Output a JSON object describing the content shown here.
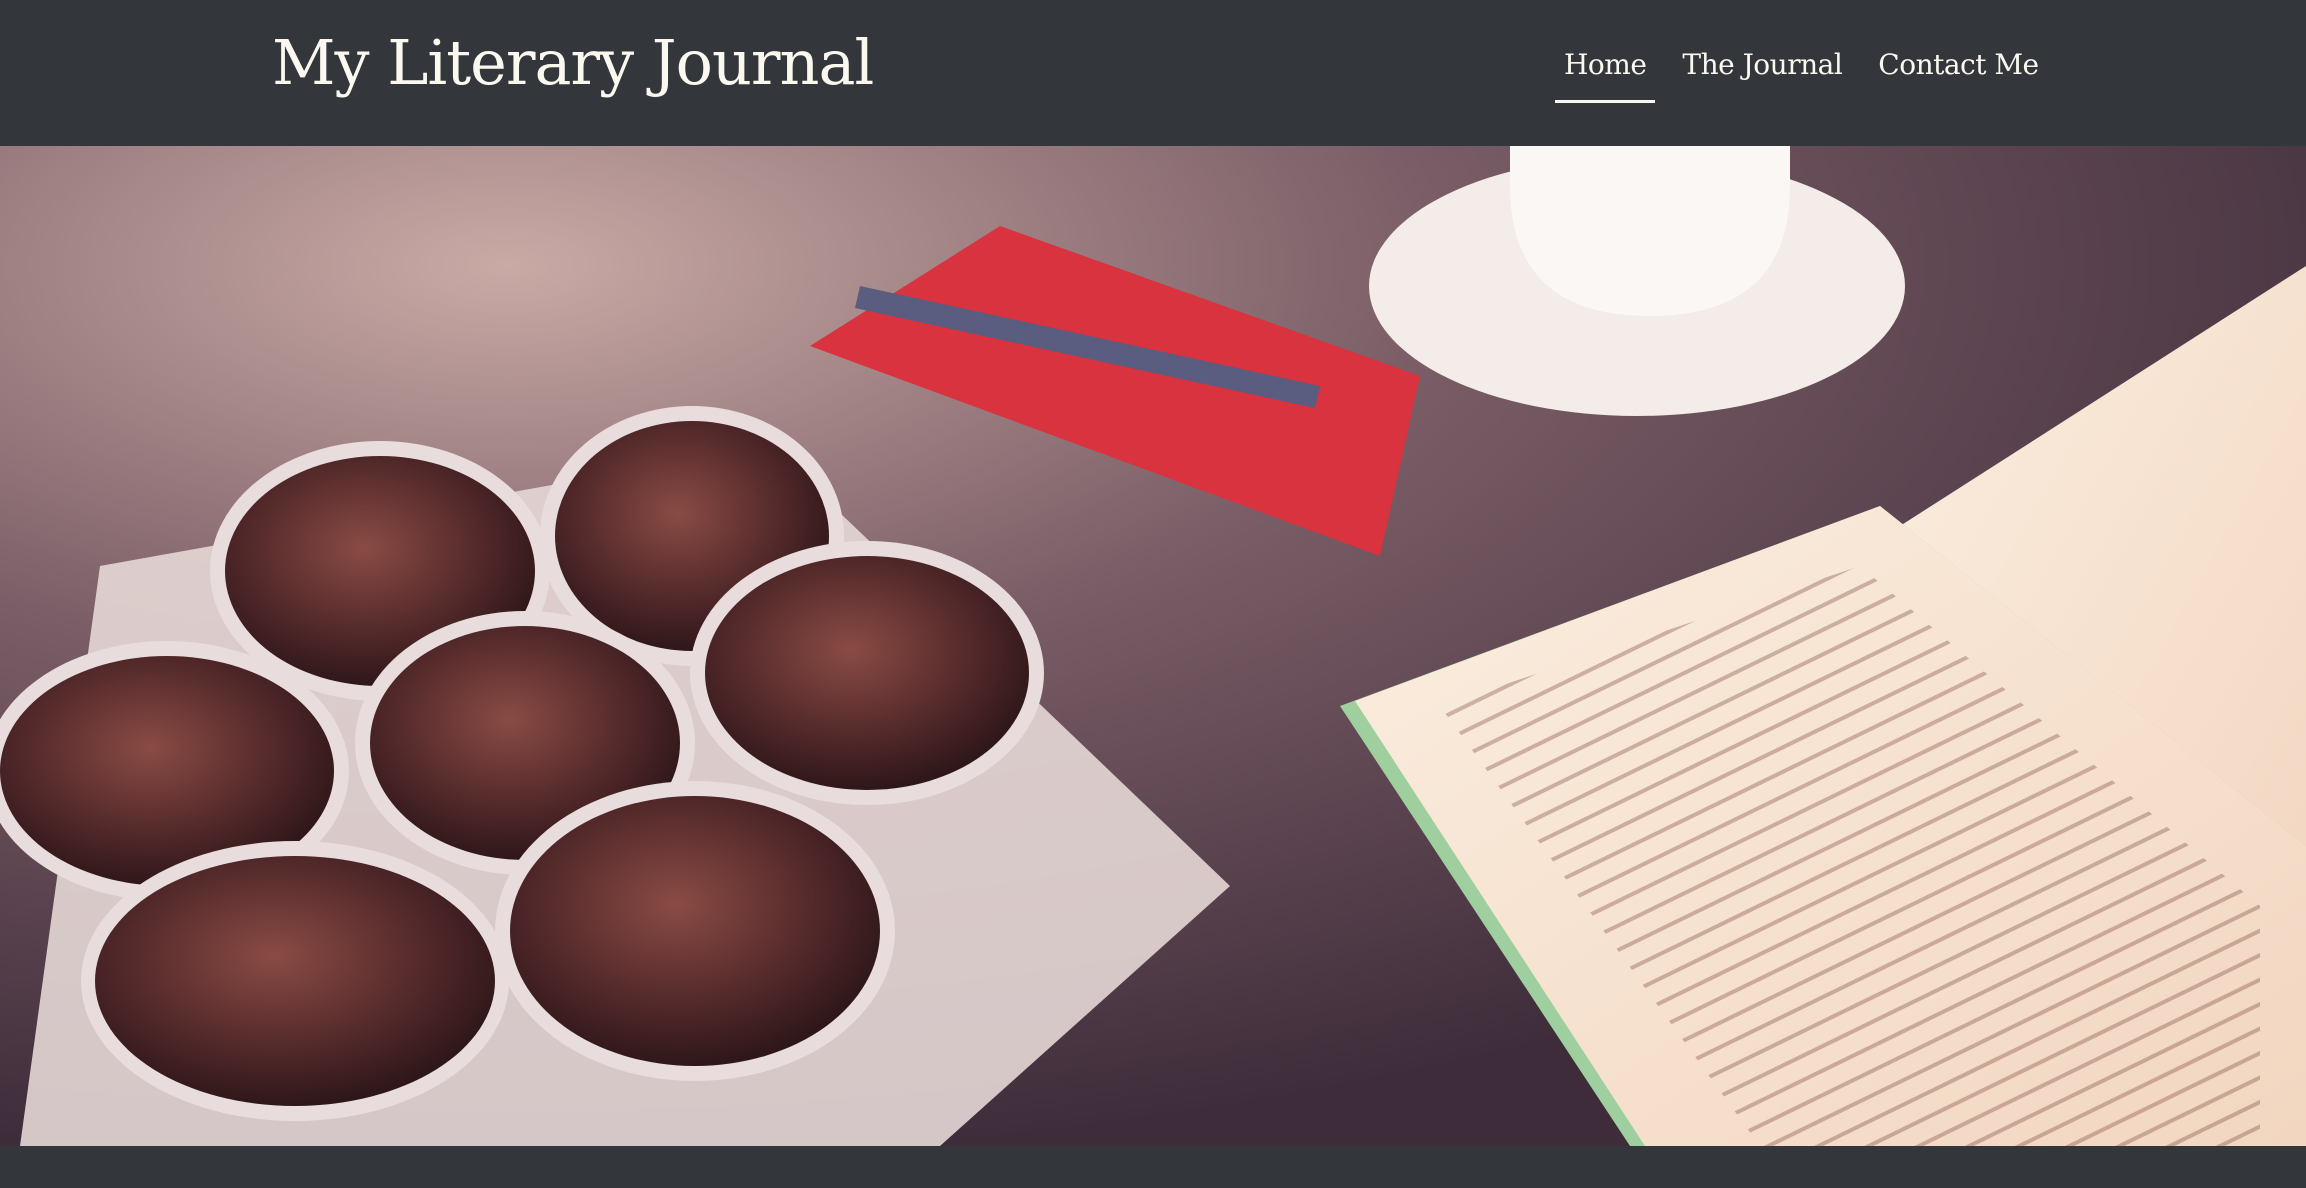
{
  "site": {
    "title": "My Literary Journal"
  },
  "nav": {
    "items": [
      {
        "label": "Home",
        "active": true
      },
      {
        "label": "The Journal",
        "active": false
      },
      {
        "label": "Contact Me",
        "active": false
      }
    ]
  }
}
